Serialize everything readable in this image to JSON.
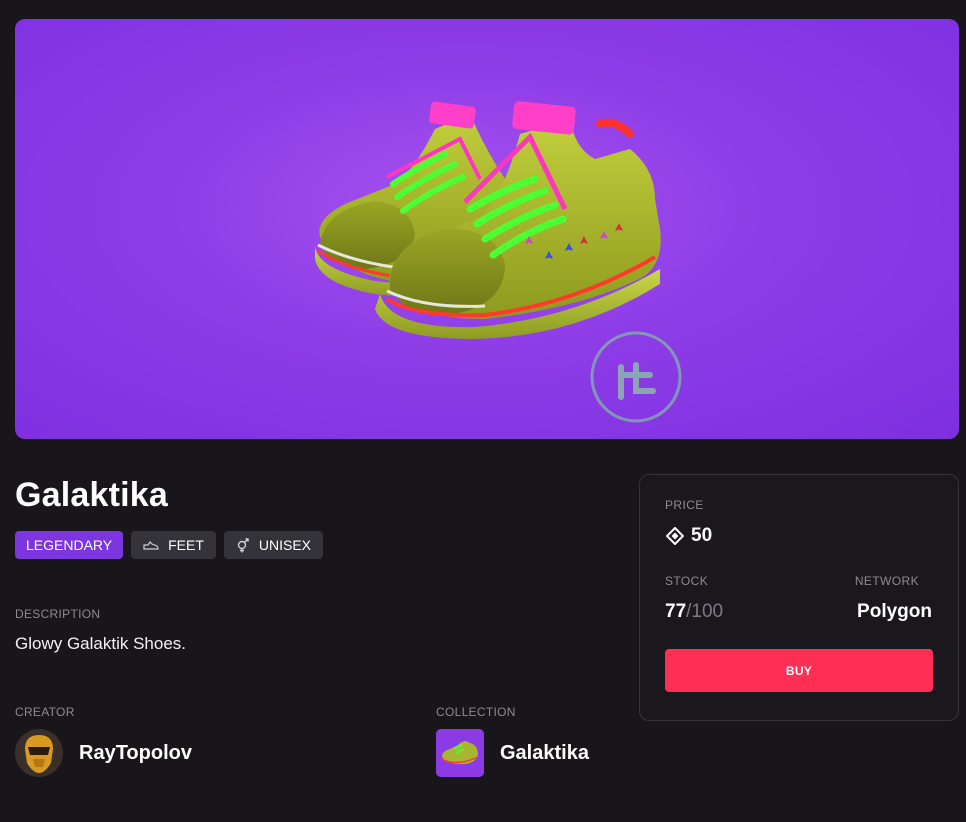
{
  "item": {
    "name": "Galaktika",
    "tags": {
      "rarity": "LEGENDARY",
      "category": "FEET",
      "gender": "UNISEX"
    },
    "description_label": "DESCRIPTION",
    "description": "Glowy Galaktik Shoes.",
    "creator_label": "CREATOR",
    "creator_name": "RayTopolov",
    "collection_label": "COLLECTION",
    "collection_name": "Galaktika"
  },
  "purchase": {
    "price_label": "PRICE",
    "price": "50",
    "stock_label": "STOCK",
    "stock_count": "77",
    "stock_total": "/100",
    "network_label": "NETWORK",
    "network": "Polygon",
    "buy_label": "BUY"
  },
  "icons": {
    "category": "shoe-icon",
    "gender": "unisex-icon",
    "price": "diamond-currency-icon",
    "watermark": "brand-watermark-icon"
  },
  "colors": {
    "page_bg": "#18161a",
    "hero_purple": "#8d3ce6",
    "legendary_tag": "#7d35dd",
    "buy_button": "#ff2e55"
  }
}
